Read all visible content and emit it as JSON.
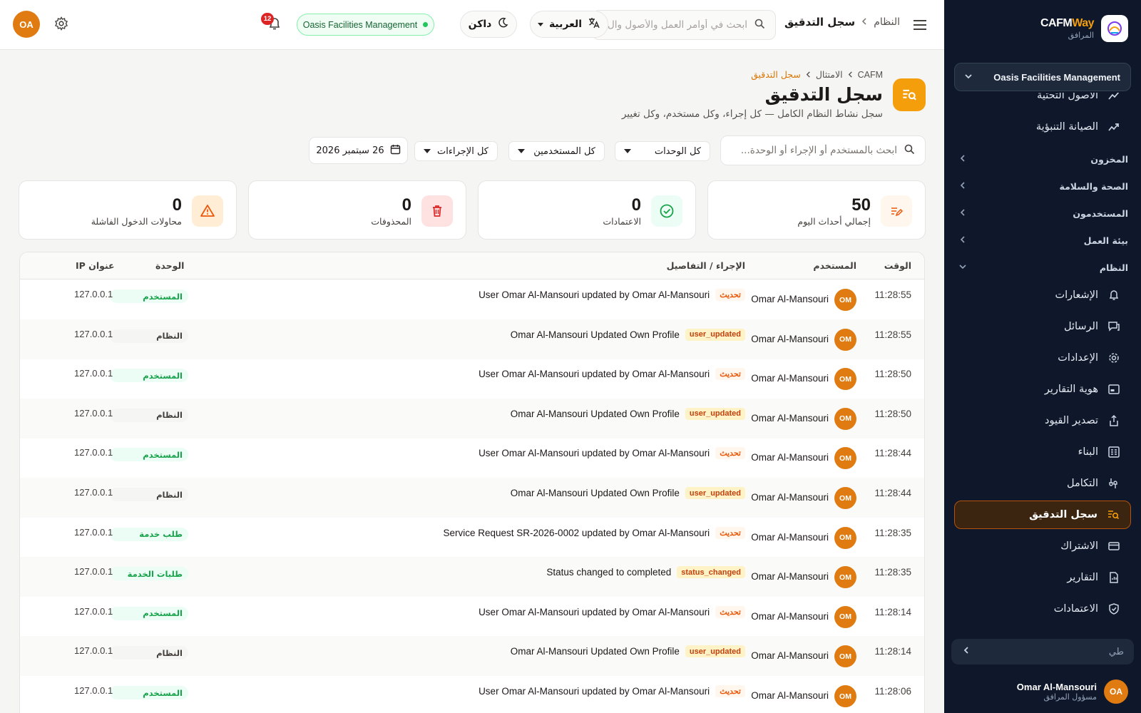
{
  "sidebar": {
    "brand": {
      "name_a": "CAFM",
      "name_b": "Way",
      "subtitle": "المرافق"
    },
    "org_selector": "Oasis Facilities Management",
    "nav_top": [
      {
        "label": "الأصول التحتية",
        "icon": "chart-line-icon"
      },
      {
        "label": "الصيانة التنبؤية",
        "icon": "trend-icon"
      }
    ],
    "sections": [
      {
        "label": "المخزون"
      },
      {
        "label": "الصحة والسلامة"
      },
      {
        "label": "المستخدمون"
      },
      {
        "label": "بيئة العمل"
      },
      {
        "label": "النظام"
      }
    ],
    "system_items": [
      {
        "label": "الإشعارات",
        "icon": "bell-icon"
      },
      {
        "label": "الرسائل",
        "icon": "chat-icon"
      },
      {
        "label": "الإعدادات",
        "icon": "gear-icon"
      },
      {
        "label": "هوية التقارير",
        "icon": "id-card-icon"
      },
      {
        "label": "تصدير القيود",
        "icon": "export-icon"
      },
      {
        "label": "البناء",
        "icon": "building-icon"
      },
      {
        "label": "التكامل",
        "icon": "plug-icon"
      },
      {
        "label": "سجل التدقيق",
        "icon": "audit-log-icon",
        "active": true
      },
      {
        "label": "الاشتراك",
        "icon": "card-icon"
      },
      {
        "label": "التقارير",
        "icon": "report-icon"
      },
      {
        "label": "الاعتمادات",
        "icon": "shield-check-icon"
      }
    ],
    "collapse_label": "طي",
    "user": {
      "initials": "OA",
      "name": "Omar Al-Mansouri",
      "role": "مسؤول المرافق"
    }
  },
  "topbar": {
    "breadcrumb_parent": "النظام",
    "breadcrumb_current": "سجل التدقيق",
    "search_placeholder": "ابحث في أوامر العمل والأصول وال...",
    "language": "العربية",
    "theme": "داكن",
    "org": "Oasis Facilities Management",
    "notifications_count": "12",
    "user_initials": "OA"
  },
  "page": {
    "breadcrumb": [
      "CAFM",
      "الامتثال",
      "سجل التدقيق"
    ],
    "title": "سجل التدقيق",
    "subtitle": "سجل نشاط النظام الكامل — كل إجراء، وكل مستخدم، وكل تغيير"
  },
  "filters": {
    "search_placeholder": "ابحث بالمستخدم أو الإجراء أو الوحدة...",
    "units": "كل الوحدات",
    "users": "كل المستخدمين",
    "actions": "كل الإجراءات",
    "date": "26 سبتمبر 2026"
  },
  "stats": [
    {
      "value": "50",
      "label": "إجمالي أحداث اليوم",
      "icon": "edit-note-icon",
      "bg": "#fff7ed",
      "fg": "#ea580c"
    },
    {
      "value": "0",
      "label": "الاعتمادات",
      "icon": "check-circle-icon",
      "bg": "#ecfdf5",
      "fg": "#16a34a"
    },
    {
      "value": "0",
      "label": "المحذوفات",
      "icon": "trash-icon",
      "bg": "#fee2e2",
      "fg": "#dc2626"
    },
    {
      "value": "0",
      "label": "محاولات الدخول الفاشلة",
      "icon": "warning-icon",
      "bg": "#ffedd5",
      "fg": "#ea580c"
    }
  ],
  "table": {
    "headers": {
      "time": "الوقت",
      "user": "المستخدم",
      "action": "الإجراء / التفاصيل",
      "unit": "الوحدة",
      "ip": "عنوان IP"
    },
    "rows": [
      {
        "time": "11:28:55",
        "initials": "OM",
        "user": "Omar Al-Mansouri",
        "tag": "تحديث",
        "tag_kind": "upd",
        "detail": "User Omar Al-Mansouri updated by Omar Al-Mansouri",
        "unit": "المستخدم",
        "unit_kind": "green",
        "ip": "127.0.0.1"
      },
      {
        "time": "11:28:55",
        "initials": "OM",
        "user": "Omar Al-Mansouri",
        "tag": "user_updated",
        "tag_kind": "raw",
        "detail": "Omar Al-Mansouri Updated Own Profile",
        "unit": "النظام",
        "unit_kind": "gray",
        "ip": "127.0.0.1"
      },
      {
        "time": "11:28:50",
        "initials": "OM",
        "user": "Omar Al-Mansouri",
        "tag": "تحديث",
        "tag_kind": "upd",
        "detail": "User Omar Al-Mansouri updated by Omar Al-Mansouri",
        "unit": "المستخدم",
        "unit_kind": "green",
        "ip": "127.0.0.1"
      },
      {
        "time": "11:28:50",
        "initials": "OM",
        "user": "Omar Al-Mansouri",
        "tag": "user_updated",
        "tag_kind": "raw",
        "detail": "Omar Al-Mansouri Updated Own Profile",
        "unit": "النظام",
        "unit_kind": "gray",
        "ip": "127.0.0.1"
      },
      {
        "time": "11:28:44",
        "initials": "OM",
        "user": "Omar Al-Mansouri",
        "tag": "تحديث",
        "tag_kind": "upd",
        "detail": "User Omar Al-Mansouri updated by Omar Al-Mansouri",
        "unit": "المستخدم",
        "unit_kind": "green",
        "ip": "127.0.0.1"
      },
      {
        "time": "11:28:44",
        "initials": "OM",
        "user": "Omar Al-Mansouri",
        "tag": "user_updated",
        "tag_kind": "raw",
        "detail": "Omar Al-Mansouri Updated Own Profile",
        "unit": "النظام",
        "unit_kind": "gray",
        "ip": "127.0.0.1"
      },
      {
        "time": "11:28:35",
        "initials": "OM",
        "user": "Omar Al-Mansouri",
        "tag": "تحديث",
        "tag_kind": "upd",
        "detail": "Service Request SR-2026-0002 updated by Omar Al-Mansouri",
        "unit": "طلب خدمة",
        "unit_kind": "green",
        "ip": "127.0.0.1"
      },
      {
        "time": "11:28:35",
        "initials": "OM",
        "user": "Omar Al-Mansouri",
        "tag": "status_changed",
        "tag_kind": "raw",
        "detail": "Status changed to completed",
        "unit": "طلبات الخدمة",
        "unit_kind": "green",
        "ip": "127.0.0.1"
      },
      {
        "time": "11:28:14",
        "initials": "OM",
        "user": "Omar Al-Mansouri",
        "tag": "تحديث",
        "tag_kind": "upd",
        "detail": "User Omar Al-Mansouri updated by Omar Al-Mansouri",
        "unit": "المستخدم",
        "unit_kind": "green",
        "ip": "127.0.0.1"
      },
      {
        "time": "11:28:14",
        "initials": "OM",
        "user": "Omar Al-Mansouri",
        "tag": "user_updated",
        "tag_kind": "raw",
        "detail": "Omar Al-Mansouri Updated Own Profile",
        "unit": "النظام",
        "unit_kind": "gray",
        "ip": "127.0.0.1"
      },
      {
        "time": "11:28:06",
        "initials": "OM",
        "user": "Omar Al-Mansouri",
        "tag": "تحديث",
        "tag_kind": "upd",
        "detail": "User Omar Al-Mansouri updated by Omar Al-Mansouri",
        "unit": "المستخدم",
        "unit_kind": "green",
        "ip": "127.0.0.1"
      }
    ]
  }
}
